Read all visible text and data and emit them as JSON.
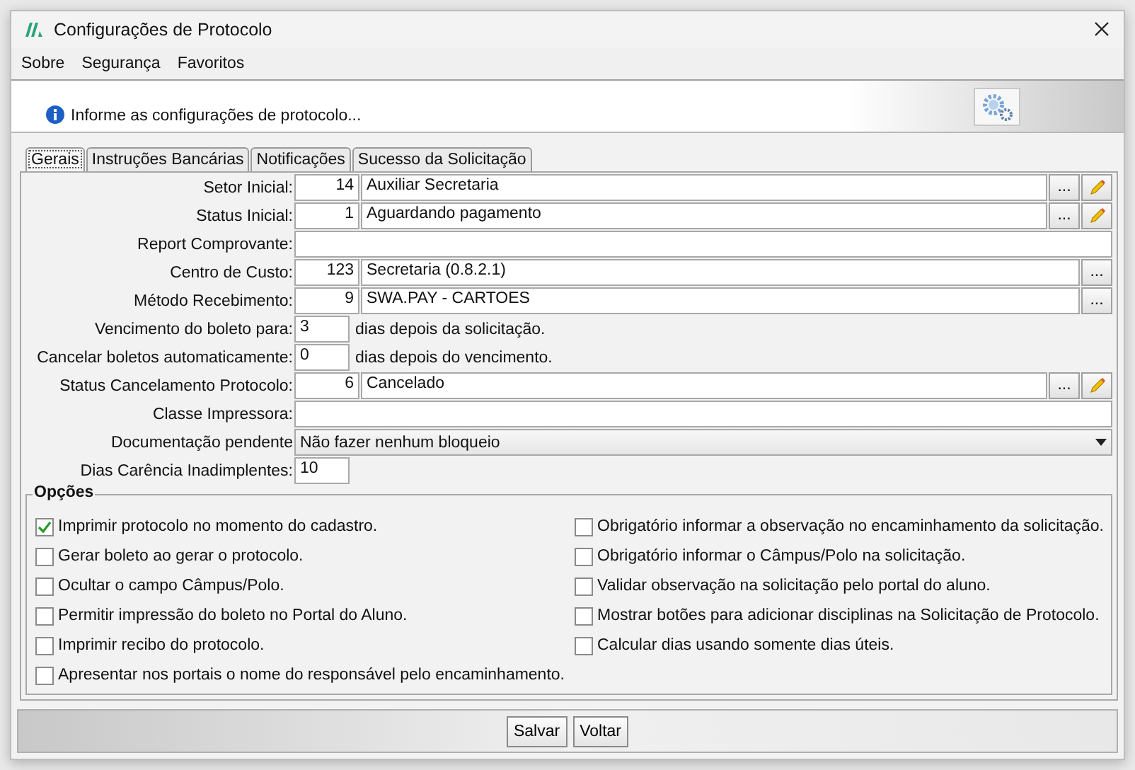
{
  "window": {
    "title": "Configurações de Protocolo"
  },
  "menu": [
    "Sobre",
    "Segurança",
    "Favoritos"
  ],
  "header": {
    "message": "Informe as configurações de protocolo..."
  },
  "tabs": [
    {
      "label": "Gerais",
      "selected": true
    },
    {
      "label": "Instruções Bancárias",
      "selected": false
    },
    {
      "label": "Notificações",
      "selected": false
    },
    {
      "label": "Sucesso da Solicitação",
      "selected": false
    }
  ],
  "fields": [
    {
      "kind": "lookup",
      "label": "Setor Inicial:",
      "code": "14",
      "value": "Auxiliar Secretaria",
      "browse": "...",
      "editable": true
    },
    {
      "kind": "lookup",
      "label": "Status Inicial:",
      "code": "1",
      "value": "Aguardando pagamento",
      "browse": "...",
      "editable": true
    },
    {
      "kind": "text",
      "label": "Report Comprovante:"
    },
    {
      "kind": "lookup",
      "label": "Centro de Custo:",
      "code": "123",
      "value": "Secretaria (0.8.2.1)",
      "browse": "...",
      "editable": false
    },
    {
      "kind": "lookup",
      "label": "Método Recebimento:",
      "code": "9",
      "value": "SWA.PAY - CARTOES",
      "browse": "...",
      "editable": false
    },
    {
      "kind": "short",
      "label": "Vencimento do boleto para:",
      "value": "3",
      "suffix": "dias depois da solicitação."
    },
    {
      "kind": "short",
      "label": "Cancelar boletos automaticamente:",
      "value": "0",
      "suffix": "dias depois do vencimento."
    },
    {
      "kind": "lookup",
      "label": "Status Cancelamento Protocolo:",
      "code": "6",
      "value": "Cancelado",
      "browse": "...",
      "editable": true
    },
    {
      "kind": "text",
      "label": "Classe Impressora:"
    },
    {
      "kind": "select",
      "label": "Documentação pendente",
      "value": "Não fazer nenhum bloqueio"
    },
    {
      "kind": "short",
      "label": "Dias Carência Inadimplentes:",
      "value": "10"
    }
  ],
  "options": {
    "title": "Opções",
    "left": [
      {
        "label": "Imprimir protocolo no momento do cadastro.",
        "checked": true
      },
      {
        "label": "Gerar boleto ao gerar o protocolo.",
        "checked": false
      },
      {
        "label": "Ocultar o campo Câmpus/Polo.",
        "checked": false
      },
      {
        "label": "Permitir impressão do boleto no Portal do Aluno.",
        "checked": false
      },
      {
        "label": "Imprimir recibo do protocolo.",
        "checked": false
      },
      {
        "label": "Apresentar nos portais o nome do responsável pelo encaminhamento.",
        "checked": false
      }
    ],
    "right": [
      {
        "label": "Obrigatório informar a observação no encaminhamento da solicitação.",
        "checked": false
      },
      {
        "label": "Obrigatório informar o Câmpus/Polo na solicitação.",
        "checked": false
      },
      {
        "label": "Validar observação na solicitação pelo portal do aluno.",
        "checked": false
      },
      {
        "label": "Mostrar botões para adicionar disciplinas na Solicitação de Protocolo.",
        "checked": false
      },
      {
        "label": "Calcular dias usando somente dias úteis.",
        "checked": false
      }
    ]
  },
  "buttons": [
    "Salvar",
    "Voltar"
  ]
}
